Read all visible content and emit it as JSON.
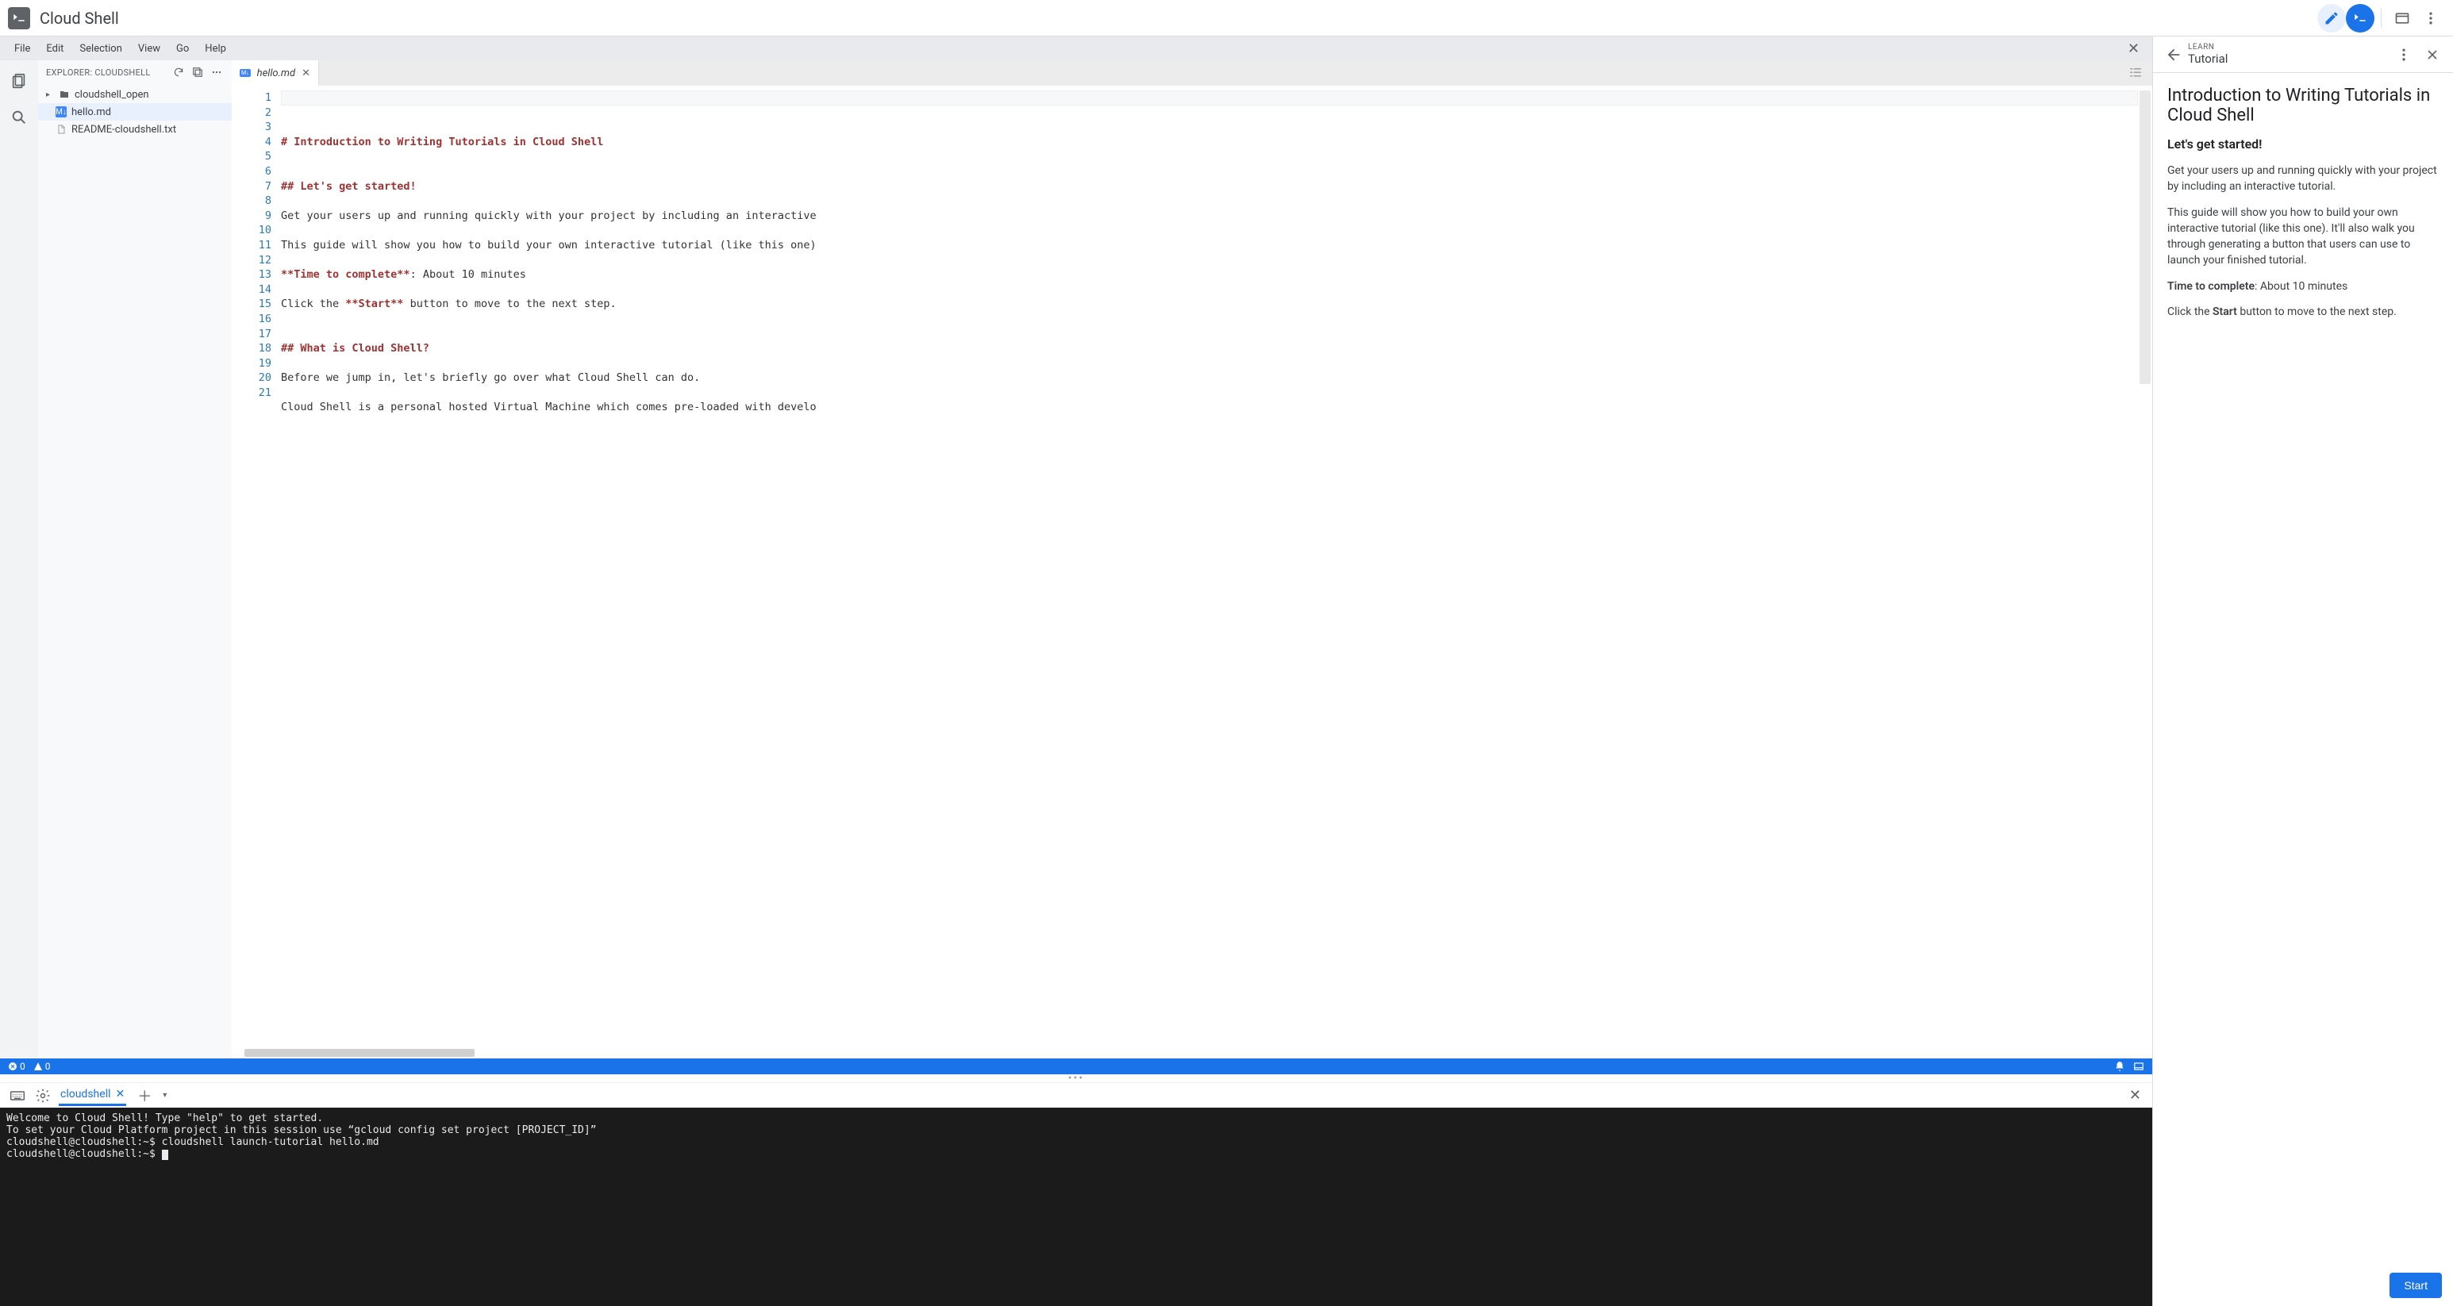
{
  "header": {
    "brand": "Cloud Shell"
  },
  "menubar": {
    "items": [
      "File",
      "Edit",
      "Selection",
      "View",
      "Go",
      "Help"
    ]
  },
  "explorer": {
    "title": "EXPLORER: CLOUDSHELL",
    "tree": {
      "folder": "cloudshell_open",
      "file_selected": "hello.md",
      "file_other": "README-cloudshell.txt"
    }
  },
  "tabs": {
    "open_file": "hello.md"
  },
  "editor": {
    "lines": [
      {
        "n": 1,
        "cls": "h",
        "t": "# Introduction to Writing Tutorials in Cloud Shell"
      },
      {
        "n": 2,
        "cls": "",
        "t": ""
      },
      {
        "n": 3,
        "cls": "",
        "t": ""
      },
      {
        "n": 4,
        "cls": "h",
        "t": "## Let's get started!"
      },
      {
        "n": 5,
        "cls": "",
        "t": ""
      },
      {
        "n": 6,
        "cls": "",
        "t": "Get your users up and running quickly with your project by including an interactive"
      },
      {
        "n": 7,
        "cls": "",
        "t": ""
      },
      {
        "n": 8,
        "cls": "",
        "t": "This guide will show you how to build your own interactive tutorial (like this one)"
      },
      {
        "n": 9,
        "cls": "",
        "t": ""
      },
      {
        "n": 10,
        "cls": "mix",
        "pre": "**Time to complete**",
        "post": ": About 10 minutes"
      },
      {
        "n": 11,
        "cls": "",
        "t": ""
      },
      {
        "n": 12,
        "cls": "mix",
        "pre2": "Click the ",
        "mid": "**Start**",
        "post": " button to move to the next step."
      },
      {
        "n": 13,
        "cls": "",
        "t": ""
      },
      {
        "n": 14,
        "cls": "",
        "t": ""
      },
      {
        "n": 15,
        "cls": "h",
        "t": "## What is Cloud Shell?"
      },
      {
        "n": 16,
        "cls": "",
        "t": ""
      },
      {
        "n": 17,
        "cls": "",
        "t": "Before we jump in, let's briefly go over what Cloud Shell can do."
      },
      {
        "n": 18,
        "cls": "",
        "t": ""
      },
      {
        "n": 19,
        "cls": "",
        "t": "Cloud Shell is a personal hosted Virtual Machine which comes pre-loaded with develo"
      },
      {
        "n": 20,
        "cls": "",
        "t": ""
      },
      {
        "n": 21,
        "cls": "",
        "t": ""
      }
    ]
  },
  "status": {
    "errors": "0",
    "warnings": "0"
  },
  "terminal_tab": {
    "label": "cloudshell"
  },
  "terminal": {
    "lines": [
      "Welcome to Cloud Shell! Type \"help\" to get started.",
      "To set your Cloud Platform project in this session use “gcloud config set project [PROJECT_ID]”",
      "cloudshell@cloudshell:~$ cloudshell launch-tutorial hello.md",
      "cloudshell@cloudshell:~$ "
    ]
  },
  "tutorial": {
    "eyebrow": "LEARN",
    "header_title": "Tutorial",
    "h1": "Introduction to Writing Tutorials in Cloud Shell",
    "h2": "Let's get started!",
    "p1": "Get your users up and running quickly with your project by including an interactive tutorial.",
    "p2": "This guide will show you how to build your own interactive tutorial (like this one). It'll also walk you through generating a button that users can use to launch your finished tutorial.",
    "time_label": "Time to complete",
    "time_value": ": About 10 minutes",
    "p4a": "Click the ",
    "p4b": "Start",
    "p4c": " button to move to the next step.",
    "start_button": "Start"
  }
}
